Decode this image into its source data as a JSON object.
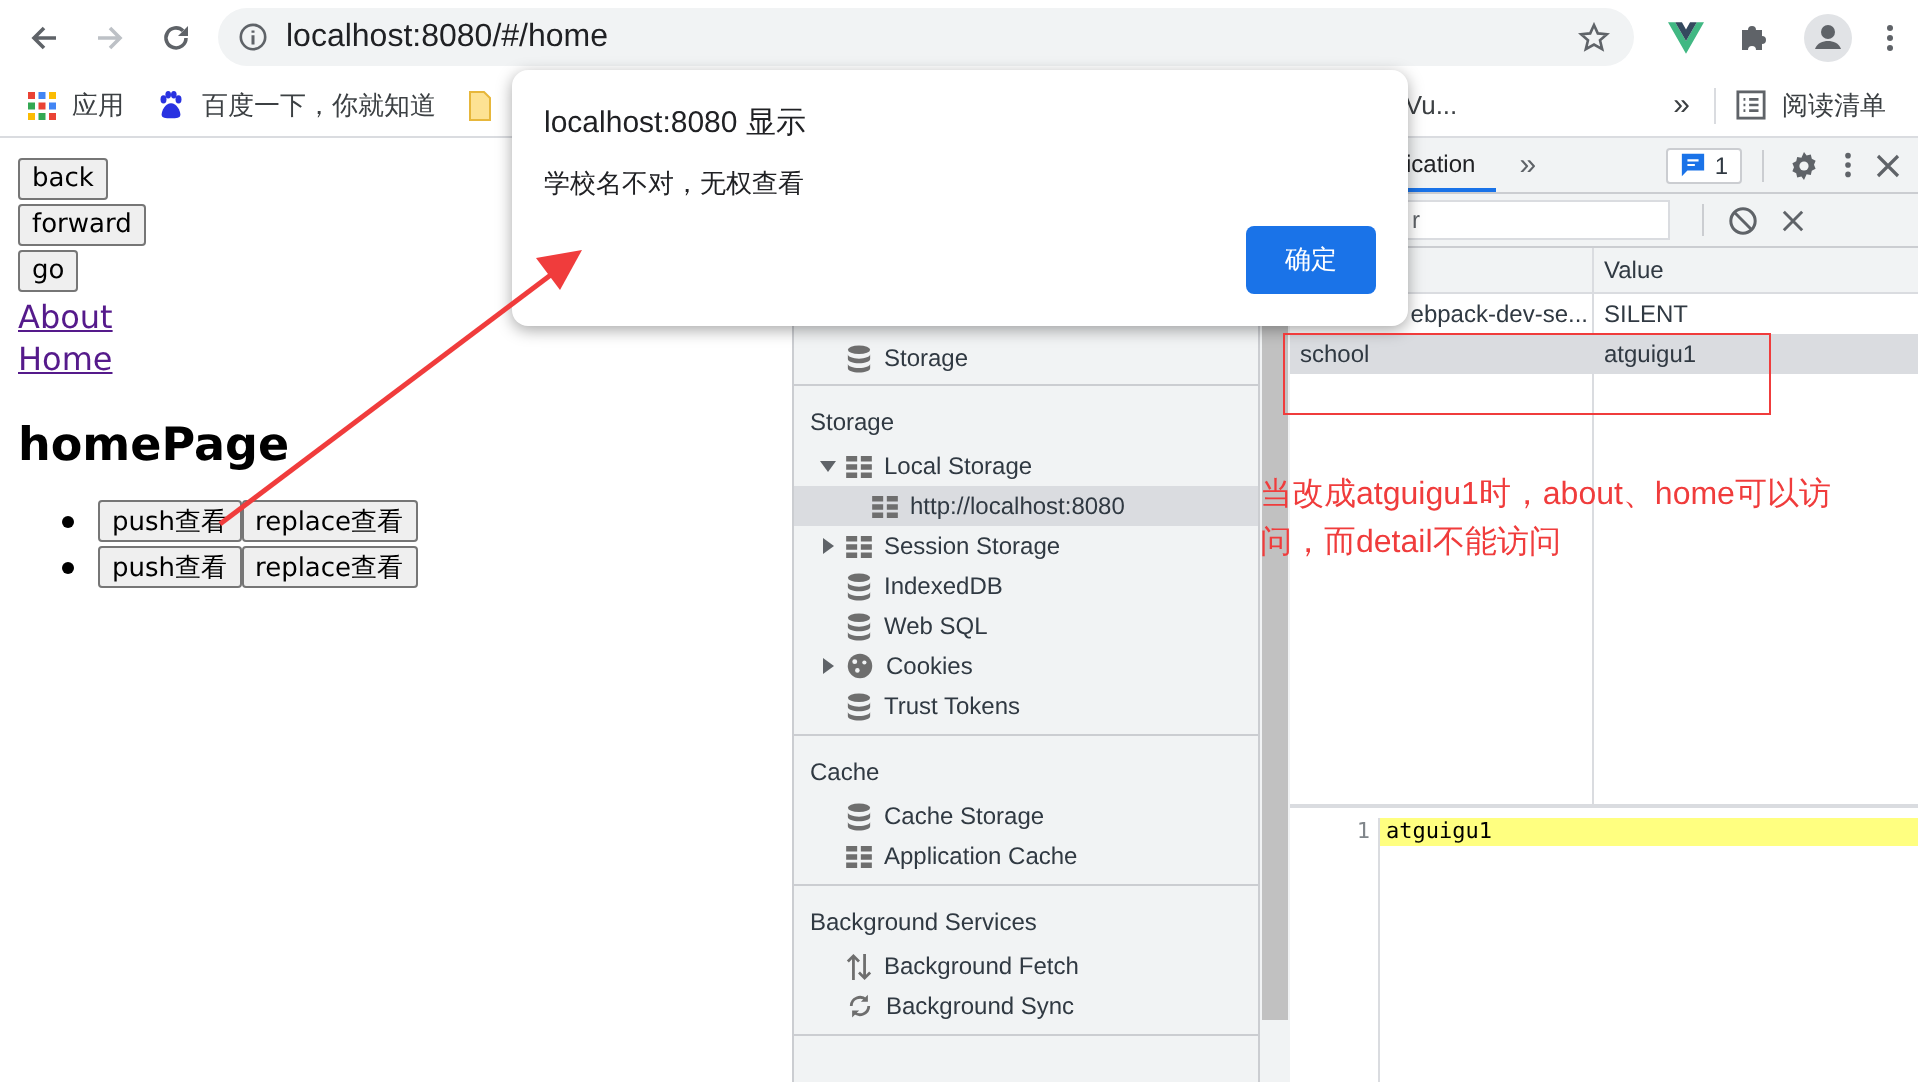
{
  "browser": {
    "address": "localhost:8080/#/home",
    "bookmarks": [
      {
        "kind": "apps",
        "label": "应用"
      },
      {
        "kind": "paw",
        "label": "百度一下，你就知道"
      },
      {
        "kind": "folder"
      },
      {
        "kind": "text",
        "label": "Vu..."
      }
    ],
    "bookmarks_overflow": "»",
    "reading_list": "阅读清单"
  },
  "page": {
    "nav_buttons": [
      "back",
      "forward",
      "go"
    ],
    "links": [
      "About",
      "Home"
    ],
    "heading": "homePage",
    "list": [
      {
        "buttons": [
          "push查看",
          "replace查看"
        ]
      },
      {
        "buttons": [
          "push查看",
          "replace查看"
        ]
      }
    ]
  },
  "devtools": {
    "tabs": [
      {
        "label": "ication",
        "selected": true
      }
    ],
    "more_tabs": "»",
    "issues_badge": "1",
    "filter": {
      "placeholder": "r"
    },
    "sidebar": [
      {
        "items": [
          {
            "kind": "database",
            "label": "Storage",
            "selected": false
          }
        ]
      },
      {
        "title": "Storage",
        "items": [
          {
            "kind": "table",
            "label": "Local Storage",
            "selected": false,
            "expanded": true,
            "children": [
              {
                "kind": "table",
                "label": "http://localhost:8080",
                "selected": true
              }
            ]
          },
          {
            "kind": "table",
            "label": "Session Storage",
            "selected": false,
            "expanded": false
          },
          {
            "kind": "database",
            "label": "IndexedDB",
            "selected": false
          },
          {
            "kind": "database",
            "label": "Web SQL",
            "selected": false
          },
          {
            "kind": "cookie",
            "label": "Cookies",
            "selected": false,
            "expanded": false
          },
          {
            "kind": "database",
            "label": "Trust Tokens",
            "selected": false
          }
        ]
      },
      {
        "title": "Cache",
        "items": [
          {
            "kind": "database",
            "label": "Cache Storage",
            "selected": false
          },
          {
            "kind": "table",
            "label": "Application Cache",
            "selected": false
          }
        ]
      },
      {
        "title": "Background Services",
        "items": [
          {
            "kind": "updown",
            "label": "Background Fetch",
            "selected": false
          },
          {
            "kind": "sync",
            "label": "Background Sync",
            "selected": false
          }
        ]
      }
    ],
    "table": {
      "value_header": "Value",
      "rows": [
        {
          "key": "ebpack-dev-se...",
          "value": "SILENT",
          "selected": false
        },
        {
          "key": "school",
          "value": "atguigu1",
          "selected": true
        }
      ]
    },
    "preview": {
      "line_number": "1",
      "text": "atguigu1"
    }
  },
  "dialog": {
    "title": "localhost:8080 显示",
    "message": "学校名不对，无权查看",
    "ok": "确定"
  },
  "annotation": {
    "text": "当改成atguigu1时，about、home可以访问，而detail不能访问"
  }
}
